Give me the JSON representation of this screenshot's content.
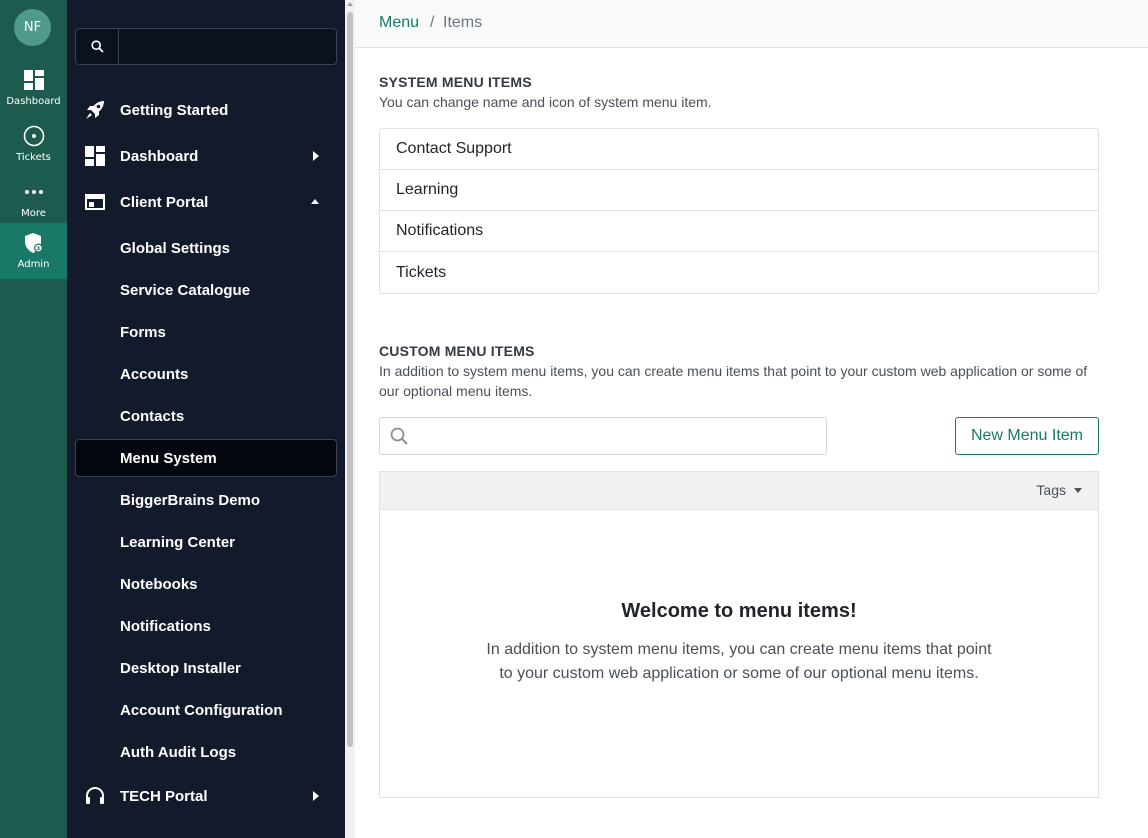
{
  "rail": {
    "avatar_initials": "NF",
    "items": [
      {
        "label": "Dashboard",
        "icon": "dashboard-icon"
      },
      {
        "label": "Tickets",
        "icon": "tickets-icon"
      },
      {
        "label": "More",
        "icon": "more-icon"
      },
      {
        "label": "Admin",
        "icon": "admin-shield-icon"
      }
    ],
    "active": "Admin"
  },
  "sidebar": {
    "search_value": "",
    "items": [
      {
        "label": "Getting Started",
        "icon": "rocket-icon"
      },
      {
        "label": "Dashboard",
        "icon": "dashboard-icon",
        "expandable": true
      },
      {
        "label": "Client Portal",
        "icon": "browser-window-icon",
        "expanded": true
      },
      {
        "label": "Global Settings"
      },
      {
        "label": "Service Catalogue"
      },
      {
        "label": "Forms"
      },
      {
        "label": "Accounts"
      },
      {
        "label": "Contacts"
      },
      {
        "label": "Menu System",
        "selected": true
      },
      {
        "label": "BiggerBrains Demo"
      },
      {
        "label": "Learning Center"
      },
      {
        "label": "Notebooks"
      },
      {
        "label": "Notifications"
      },
      {
        "label": "Desktop Installer"
      },
      {
        "label": "Account Configuration"
      },
      {
        "label": "Auth Audit Logs"
      },
      {
        "label": "TECH Portal",
        "icon": "headset-icon",
        "expandable": true
      }
    ]
  },
  "breadcrumb": {
    "root": "Menu",
    "separator": "/",
    "current": "Items"
  },
  "system_section": {
    "title": "SYSTEM MENU ITEMS",
    "description": "You can change name and icon of system menu item.",
    "items": [
      "Contact Support",
      "Learning",
      "Notifications",
      "Tickets"
    ]
  },
  "custom_section": {
    "title": "CUSTOM MENU ITEMS",
    "description": "In addition to system menu items, you can create menu items that point to your custom web application or some of our optional menu items.",
    "search_value": "",
    "new_button_label": "New Menu Item",
    "tags_label": "Tags",
    "empty_title": "Welcome to menu items!",
    "empty_text": "In addition to system menu items, you can create menu items that point to your custom web application or some of our optional menu items."
  },
  "colors": {
    "accent": "#187a66",
    "rail": "#1d5b4f",
    "sidebar": "#121a2b"
  }
}
